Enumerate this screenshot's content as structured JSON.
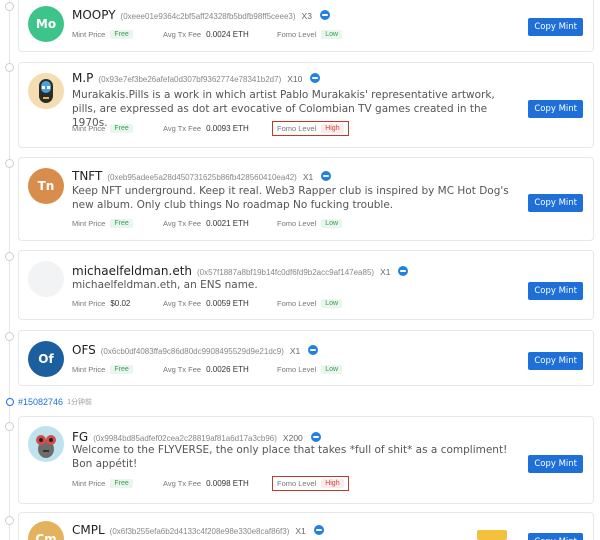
{
  "labels": {
    "mint_price": "Mint Price",
    "avg_tx_fee": "Avg Tx Fee",
    "fomo_level": "Fomo Level",
    "copy_mint": "Copy Mint"
  },
  "colors": {
    "accent": "#1f6fd8",
    "low": "#3a9b56",
    "high": "#d0483d",
    "highlight_box": "#c0392b"
  },
  "block": {
    "number": "#15082746",
    "time": "1分钟前"
  },
  "items": [
    {
      "avatar_text": "Mo",
      "avatar_color": "#3cc48a",
      "name": "MOOPY",
      "address": "(0xeee01e9364c2bf5aff24328fb5bdfb98ff5ceee3)",
      "count": "X3",
      "description": "",
      "mint_price": "Free",
      "avg_tx_fee": "0.0024 ETH",
      "fomo_level": "Low"
    },
    {
      "avatar_text": "",
      "avatar_color": "#f4ddb0",
      "name": "M.P",
      "address": "(0x93e7ef3be26afefa0d307bf9362774e78341b2d7)",
      "count": "X10",
      "description": "Murakakis.Pills is a work in which artist Pablo Murakakis' representative artwork, pills, are expressed as dot art evocative of Colombian TV games created in the 1970s.",
      "mint_price": "Free",
      "avg_tx_fee": "0.0093 ETH",
      "fomo_level": "High"
    },
    {
      "avatar_text": "Tn",
      "avatar_color": "#d98d4c",
      "name": "TNFT",
      "address": "(0xeb95adee5a28d450731625b86fb428560410ea42)",
      "count": "X1",
      "description": "Keep NFT underground.  Keep it real.  Web3 Rapper club is inspired by MC Hot Dog's new album.   Only club things No roadmap No fucking trouble.",
      "mint_price": "Free",
      "avg_tx_fee": "0.0021 ETH",
      "fomo_level": "Low"
    },
    {
      "avatar_text": "",
      "avatar_color": "#f2f3f5",
      "name": "michaelfeldman.eth",
      "address": "(0x57f1887a8bf19b14fc0df6fd9b2acc9af147ea85)",
      "count": "X1",
      "description": "michaelfeldman.eth, an ENS name.",
      "mint_price": "$0.02",
      "avg_tx_fee": "0.0059 ETH",
      "fomo_level": "Low"
    },
    {
      "avatar_text": "Of",
      "avatar_color": "#1c5f9e",
      "name": "OFS",
      "address": "(0x6cb0df4083ffa9c86d80dc9908495529d9e21dc9)",
      "count": "X1",
      "description": "",
      "mint_price": "Free",
      "avg_tx_fee": "0.0026 ETH",
      "fomo_level": "Low"
    },
    {
      "avatar_text": "",
      "avatar_color": "#bfe3ee",
      "name": "FG",
      "address": "(0x9984bd85adfef02cea2c28819af81a6d17a3cb96)",
      "count": "X200",
      "description": "Welcome to the FLYVERSE, the only place that takes *full of shit* as a compliment! Bon appétit!",
      "mint_price": "Free",
      "avg_tx_fee": "0.0098 ETH",
      "fomo_level": "High"
    },
    {
      "avatar_text": "Cm",
      "avatar_color": "#e2b25e",
      "name": "CMPL",
      "address": "(0x6f3b255efa6b2d4133c4f208e98e330e8caf86f3)",
      "count": "X1",
      "description": "",
      "mint_price": "",
      "avg_tx_fee": "",
      "fomo_level": ""
    }
  ]
}
